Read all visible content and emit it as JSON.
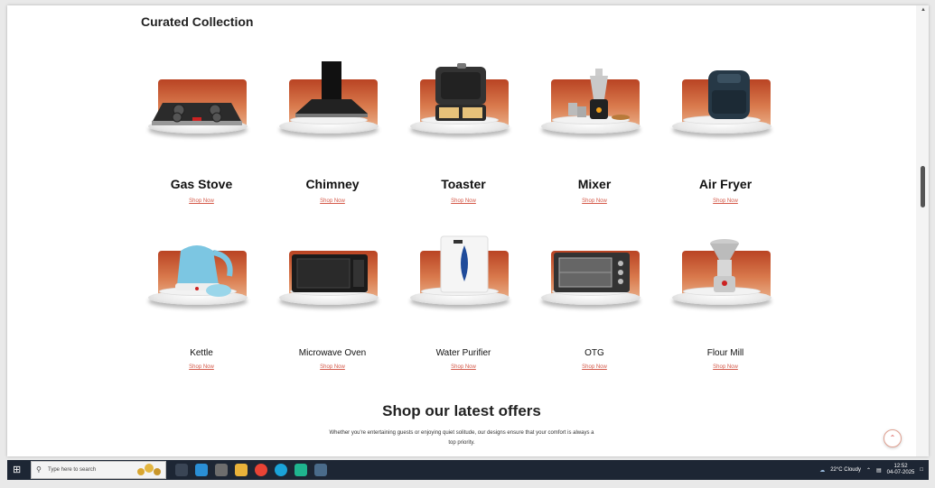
{
  "section": {
    "title": "Curated Collection"
  },
  "products_row1": [
    {
      "name": "Gas Stove",
      "link": "Shop Now"
    },
    {
      "name": "Chimney",
      "link": "Shop Now"
    },
    {
      "name": "Toaster",
      "link": "Shop Now"
    },
    {
      "name": "Mixer",
      "link": "Shop Now"
    },
    {
      "name": "Air Fryer",
      "link": "Shop Now"
    }
  ],
  "products_row2": [
    {
      "name": "Kettle",
      "link": "Shop Now"
    },
    {
      "name": "Microwave Oven",
      "link": "Shop Now"
    },
    {
      "name": "Water Purifier",
      "link": "Shop Now"
    },
    {
      "name": "OTG",
      "link": "Shop Now"
    },
    {
      "name": "Flour Mill",
      "link": "Shop Now"
    }
  ],
  "offers": {
    "title": "Shop our latest offers",
    "description": "Whether you're entertaining guests or enjoying quiet solitude, our designs ensure that your comfort is always a top priority."
  },
  "taskbar": {
    "search_placeholder": "Type here to search",
    "weather": "22°C  Cloudy",
    "time": "12:52",
    "date": "04-07-2025"
  },
  "icons": {
    "start": "windows-start-icon",
    "search": "search-icon",
    "scroll_top": "chevron-up-icon"
  },
  "colors": {
    "accent": "#d45a4a",
    "card_bg": "#c65a35",
    "taskbar": "#1d2634"
  }
}
